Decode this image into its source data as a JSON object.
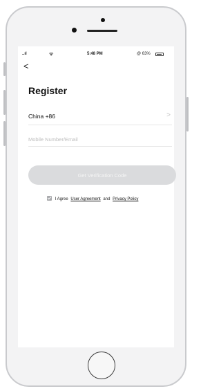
{
  "status_bar": {
    "signal": "..ıl",
    "wifi": "ᯤ",
    "time": "5:48 PM",
    "battery": "@ 63%"
  },
  "nav": {
    "back_glyph": "<"
  },
  "page": {
    "title": "Register"
  },
  "country": {
    "label": "China +86",
    "chevron": ">"
  },
  "mobile_input": {
    "placeholder": "Mobile Number/Email",
    "value": ""
  },
  "verify_button": {
    "label": "Get Verification Code"
  },
  "agreement": {
    "prefix": "I Agree",
    "link1": "User Agreement",
    "conjunction": "and",
    "link2": "Privacy Policy",
    "checked": true
  },
  "colors": {
    "button_bg": "#dadbdd",
    "phone_body": "#f3f3f4",
    "divider": "#e6e6e6"
  },
  "icons": {
    "back": "chevron-left-icon",
    "row_chevron": "chevron-right-icon",
    "wifi": "wifi-icon",
    "battery": "battery-icon"
  }
}
